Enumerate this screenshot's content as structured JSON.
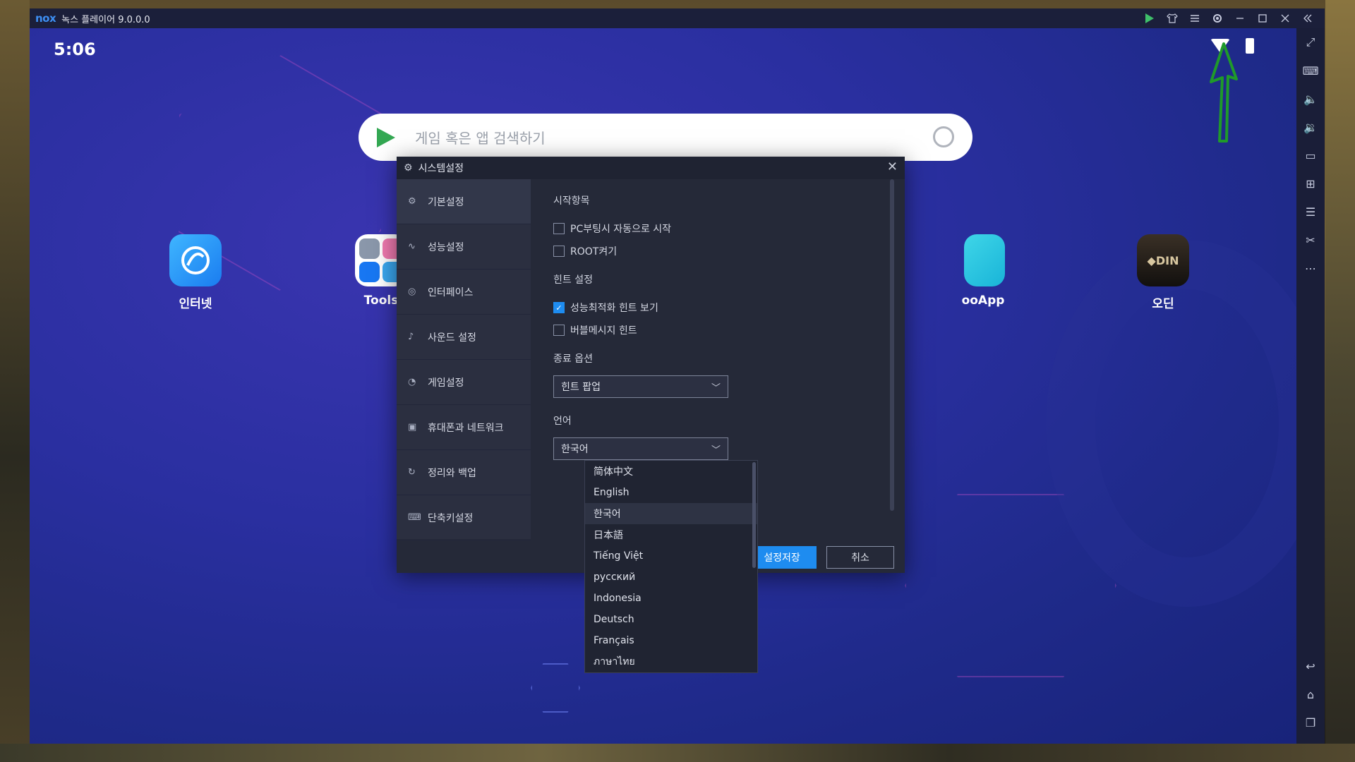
{
  "window": {
    "logo": "nox",
    "title": "녹스 플레이어 9.0.0.0"
  },
  "status": {
    "time": "5:06"
  },
  "search": {
    "placeholder": "게임 혹은 앱 검색하기"
  },
  "apps": [
    {
      "label": "인터넷"
    },
    {
      "label": "Tools"
    },
    {
      "label": "ooApp"
    },
    {
      "label": "오딘"
    }
  ],
  "dialog": {
    "title": "시스템설정",
    "close": "✕",
    "sidebar": [
      {
        "label": "기본설정"
      },
      {
        "label": "성능설정"
      },
      {
        "label": "인터페이스"
      },
      {
        "label": "사운드 설정"
      },
      {
        "label": "게임설정"
      },
      {
        "label": "휴대폰과 네트워크"
      },
      {
        "label": "정리와 백업"
      },
      {
        "label": "단축키설정"
      }
    ],
    "startup": {
      "title": "시작항목",
      "options": [
        {
          "label": "PC부팅시 자동으로 시작",
          "checked": false
        },
        {
          "label": "ROOT켜기",
          "checked": false
        }
      ]
    },
    "hints": {
      "title": "힌트 설정",
      "options": [
        {
          "label": "성능최적화 힌트 보기",
          "checked": true
        },
        {
          "label": "버블메시지 힌트",
          "checked": false
        }
      ]
    },
    "exit": {
      "title": "종료 옵션",
      "value": "힌트 팝업"
    },
    "language": {
      "title": "언어",
      "value": "한국어",
      "options": [
        "简体中文",
        "English",
        "한국어",
        "日本語",
        "Tiếng Việt",
        "русский",
        "Indonesia",
        "Deutsch",
        "Français",
        "ภาษาไทย"
      ]
    },
    "save_label": "설정저장",
    "cancel_label": "취소"
  },
  "colors": {
    "accent": "#1e8cf0",
    "annotation": "#1f9a2a"
  }
}
